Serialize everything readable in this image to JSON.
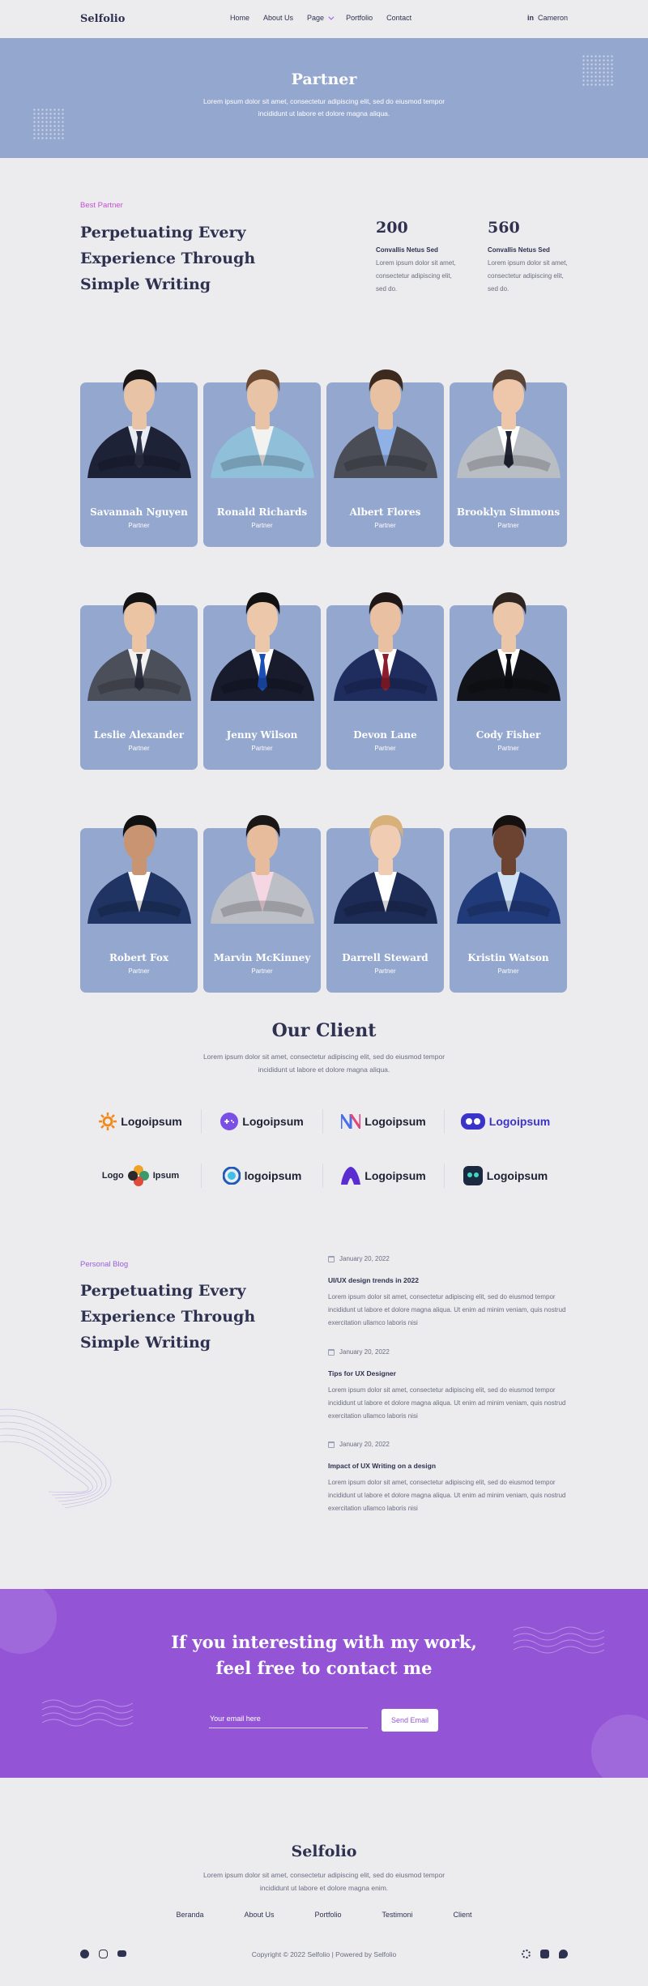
{
  "nav": {
    "brand": "Selfolio",
    "items": [
      "Home",
      "About Us",
      "Page",
      "Portfolio",
      "Contact"
    ],
    "user": "Cameron"
  },
  "hero": {
    "title": "Partner",
    "text": "Lorem ipsum dolor sit amet, consectetur adipiscing elit, sed do eiusmod tempor incididunt ut labore et dolore magna aliqua."
  },
  "intro": {
    "tag": "Best Partner",
    "heading": "Perpetuating Every Experience Through Simple Writing",
    "stats": [
      {
        "num": "200",
        "label": "Convallis Netus Sed",
        "desc": "Lorem ipsum dolor sit amet, consectetur adipiscing elit, sed do."
      },
      {
        "num": "560",
        "label": "Convallis Netus Sed",
        "desc": "Lorem ipsum dolor sit amet, consectetur adipiscing elit, sed do."
      }
    ]
  },
  "partners": [
    {
      "name": "Savannah Nguyen",
      "role": "Partner",
      "suit": "#1d2236",
      "shirt": "#e9ecf3",
      "tie": "#2b3045",
      "skin": "#e9c3a6",
      "hair": "#1b1717"
    },
    {
      "name": "Ronald Richards",
      "role": "Partner",
      "suit": "#8fbfd9",
      "shirt": "#f2f2f0",
      "tie": "",
      "skin": "#e9c3a6",
      "hair": "#6b4a33"
    },
    {
      "name": "Albert Flores",
      "role": "Partner",
      "suit": "#4a4d55",
      "shirt": "#8fb1e6",
      "tie": "",
      "skin": "#e8c0a2",
      "hair": "#3c2a1e"
    },
    {
      "name": "Brooklyn Simmons",
      "role": "Partner",
      "suit": "#b9bdc4",
      "shirt": "#ffffff",
      "tie": "#222531",
      "skin": "#eec7ab",
      "hair": "#5a4436"
    },
    {
      "name": "Leslie Alexander",
      "role": "Partner",
      "suit": "#4b4f5a",
      "shirt": "#f2f2f2",
      "tie": "#2e3140",
      "skin": "#ebc4a4",
      "hair": "#141313"
    },
    {
      "name": "Jenny Wilson",
      "role": "Partner",
      "suit": "#171b2c",
      "shirt": "#ffffff",
      "tie": "#1b4fb6",
      "skin": "#ecc7a9",
      "hair": "#121111"
    },
    {
      "name": "Devon Lane",
      "role": "Partner",
      "suit": "#1e2c5e",
      "shirt": "#ffffff",
      "tie": "#8d1d2c",
      "skin": "#e9c1a2",
      "hair": "#1f1715"
    },
    {
      "name": "Cody Fisher",
      "role": "Partner",
      "suit": "#121318",
      "shirt": "#ffffff",
      "tie": "#0e0f14",
      "skin": "#ecc6a8",
      "hair": "#2e2420"
    },
    {
      "name": "Robert Fox",
      "role": "Partner",
      "suit": "#1f3463",
      "shirt": "#ffffff",
      "tie": "",
      "skin": "#c99472",
      "hair": "#111111"
    },
    {
      "name": "Marvin McKinney",
      "role": "Partner",
      "suit": "#bcbfc5",
      "shirt": "#f4d7e2",
      "tie": "",
      "skin": "#e6bc9c",
      "hair": "#1b1717"
    },
    {
      "name": "Darrell Steward",
      "role": "Partner",
      "suit": "#1d2b57",
      "shirt": "#ffffff",
      "tie": "",
      "skin": "#f0ccb2",
      "hair": "#d7b07a"
    },
    {
      "name": "Kristin Watson",
      "role": "Partner",
      "suit": "#213b7a",
      "shirt": "#cfe1f5",
      "tie": "",
      "skin": "#6b4330",
      "hair": "#151111"
    }
  ],
  "client": {
    "heading": "Our Client",
    "text": "Lorem ipsum dolor sit amet, consectetur adipiscing elit, sed do eiusmod tempor incididunt ut labore et dolore magna aliqua.",
    "logos": [
      {
        "text": "Logoipsum",
        "icon": "sun-logo-icon",
        "color": "#f08a1c"
      },
      {
        "text": "Logoipsum",
        "icon": "gamepad-logo-icon",
        "color": "#7a4fe6"
      },
      {
        "text": "Logoipsum",
        "icon": "n-logo-icon",
        "color": "#e2457a"
      },
      {
        "text": "Logoipsum",
        "icon": "rounded-logo-icon",
        "color": "#3b34c9"
      },
      {
        "text": "Logo",
        "text2": "Ipsum",
        "icon": "flower-logo-icon",
        "color": "#f0a12a"
      },
      {
        "text": "logoipsum",
        "icon": "circle-logo-icon",
        "color": "#1e5bb8"
      },
      {
        "text": "Logoipsum",
        "icon": "a-logo-icon",
        "color": "#5b2dd1"
      },
      {
        "text": "Logoipsum",
        "icon": "bot-logo-icon",
        "color": "#1b2a40"
      }
    ]
  },
  "blog": {
    "tag": "Personal Blog",
    "heading": "Perpetuating Every Experience Through Simple Writing",
    "posts": [
      {
        "date": "January 20, 2022",
        "title": "UI/UX design trends in 2022",
        "body": "Lorem ipsum dolor sit amet, consectetur adipiscing elit, sed do eiusmod tempor incididunt ut labore et dolore magna aliqua. Ut enim ad minim veniam, quis nostrud exercitation ullamco laboris nisi"
      },
      {
        "date": "January 20, 2022",
        "title": "Tips for UX Designer",
        "body": "Lorem ipsum dolor sit amet, consectetur adipiscing elit, sed do eiusmod tempor incididunt ut labore et dolore magna aliqua. Ut enim ad minim veniam, quis nostrud exercitation ullamco laboris nisi"
      },
      {
        "date": "January 20, 2022",
        "title": "Impact of UX Writing on a design",
        "body": "Lorem ipsum dolor sit amet, consectetur adipiscing elit, sed do eiusmod tempor incididunt ut labore et dolore magna aliqua. Ut enim ad minim veniam, quis nostrud exercitation ullamco laboris nisi"
      }
    ]
  },
  "cta": {
    "line1": "If you interesting with my work,",
    "line2": "feel free to contact me",
    "email_placeholder": "Your email here",
    "button": "Send Email"
  },
  "footer": {
    "brand": "Selfolio",
    "text": "Lorem ipsum dolor sit amet, consectetur adipiscing elit, sed do eiusmod tempor incididunt ut labore et dolore magna enim.",
    "links": [
      "Beranda",
      "About Us",
      "Portfolio",
      "Testimoni",
      "Client"
    ],
    "copyright": "Copyright © 2022 Selfolio | Powered by Selfolio"
  },
  "colors": {
    "primary": "#9355d6",
    "card": "#94a7cf",
    "dark": "#2e3150",
    "tag": "#c34fd0"
  }
}
